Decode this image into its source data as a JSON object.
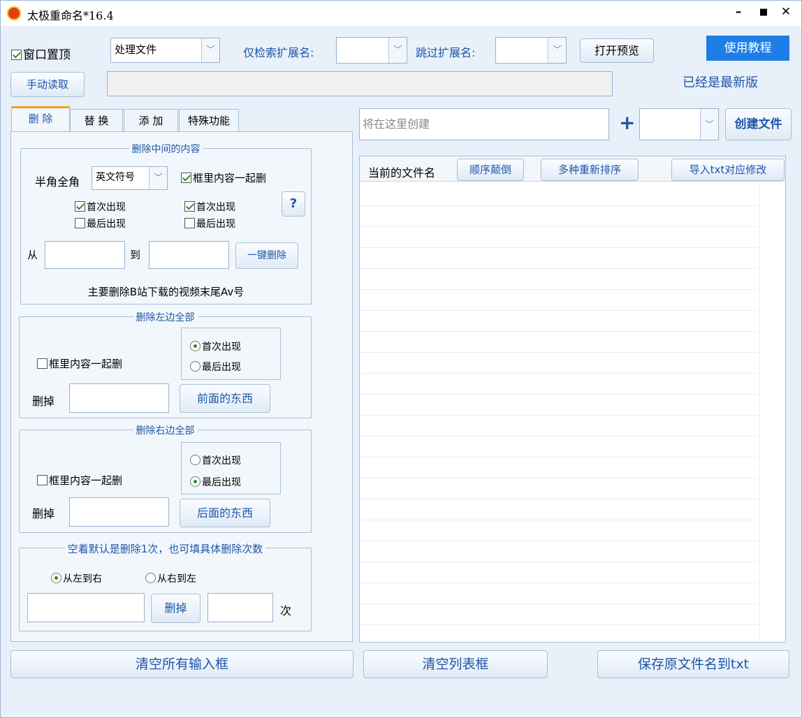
{
  "window": {
    "title": "太极重命名*16.4",
    "minimize": "–",
    "maximize": "■",
    "close": "✕"
  },
  "toolbar": {
    "topmost_label": "窗口置顶",
    "topmost_checked": true,
    "mode_select": "处理文件",
    "search_ext_label": "仅检索扩展名:",
    "search_ext_value": "",
    "skip_ext_label": "跳过扩展名:",
    "skip_ext_value": "",
    "preview_button": "打开预览",
    "tutorial_button": "使用教程",
    "manual_read_button": "手动读取",
    "path_value": "",
    "version_status": "已经是最新版"
  },
  "tabs": [
    {
      "label": "删 除",
      "active": true
    },
    {
      "label": "替 换",
      "active": false
    },
    {
      "label": "添 加",
      "active": false
    },
    {
      "label": "特殊功能",
      "active": false
    }
  ],
  "delete_middle": {
    "title": "删除中间的内容",
    "width_label": "半角全角",
    "symbol_select": "英文符号",
    "with_box_label": "框里内容一起删",
    "with_box_checked": true,
    "left_first_label": "首次出现",
    "left_first_checked": true,
    "left_last_label": "最后出现",
    "left_last_checked": false,
    "right_first_label": "首次出现",
    "right_first_checked": true,
    "right_last_label": "最后出现",
    "right_last_checked": false,
    "help_button": "?",
    "from_label": "从",
    "to_label": "到",
    "one_click_button": "一键删除",
    "note": "主要删除B站下载的视频末尾Av号"
  },
  "delete_left": {
    "title": "删除左边全部",
    "with_box_label": "框里内容一起删",
    "first_label": "首次出现",
    "last_label": "最后出现",
    "selected": "first",
    "remove_label": "删掉",
    "action_button": "前面的东西"
  },
  "delete_right": {
    "title": "删除右边全部",
    "with_box_label": "框里内容一起删",
    "first_label": "首次出现",
    "last_label": "最后出现",
    "selected": "last",
    "remove_label": "删掉",
    "action_button": "后面的东西"
  },
  "delete_count": {
    "title": "空着默认是删除1次，也可填具体删除次数",
    "ltr_label": "从左到右",
    "rtl_label": "从右到左",
    "selected": "ltr",
    "remove_button": "删掉",
    "times_label": "次"
  },
  "create": {
    "placeholder": "将在这里创建",
    "plus_icon": "+",
    "create_button": "创建文件"
  },
  "file_list": {
    "col_current": "当前的文件名",
    "reverse_button": "顺序颠倒",
    "resort_button": "多种重新排序",
    "import_button": "导入txt对应修改"
  },
  "bottom": {
    "clear_inputs": "清空所有输入框",
    "clear_list": "清空列表框",
    "save_names": "保存原文件名到txt"
  },
  "colors": {
    "accent": "#1f55a8",
    "tutorial_bg": "#1e7ee6",
    "tab_active_top": "#f0a020"
  }
}
